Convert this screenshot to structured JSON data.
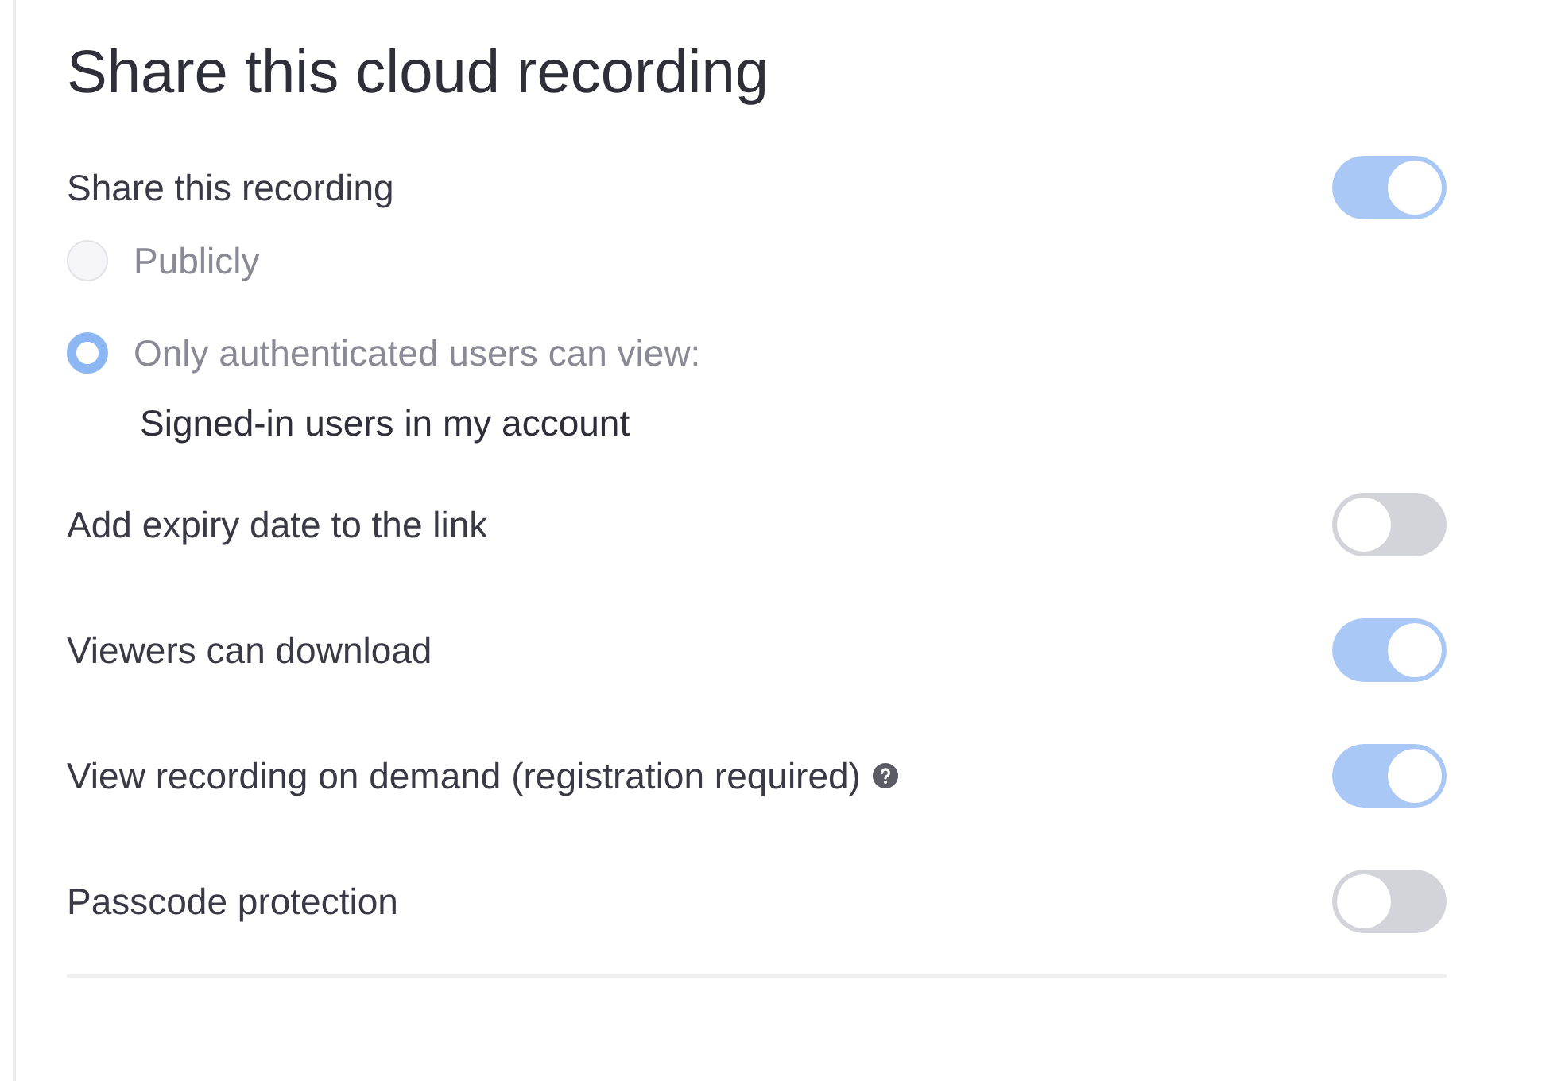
{
  "title": "Share this cloud recording",
  "share": {
    "label": "Share this recording",
    "on": true
  },
  "audience": [
    {
      "label": "Publicly",
      "selected": false,
      "disabled": true
    },
    {
      "label": "Only authenticated users can view:",
      "selected": true,
      "disabled": true
    }
  ],
  "audience_note": "Signed-in users in my account",
  "settings": [
    {
      "label": "Add expiry date to the link",
      "on": false,
      "help": false
    },
    {
      "label": "Viewers can download",
      "on": true,
      "help": false
    },
    {
      "label": "View recording on demand (registration required)",
      "on": true,
      "help": true
    },
    {
      "label": "Passcode protection",
      "on": false,
      "help": false
    }
  ]
}
